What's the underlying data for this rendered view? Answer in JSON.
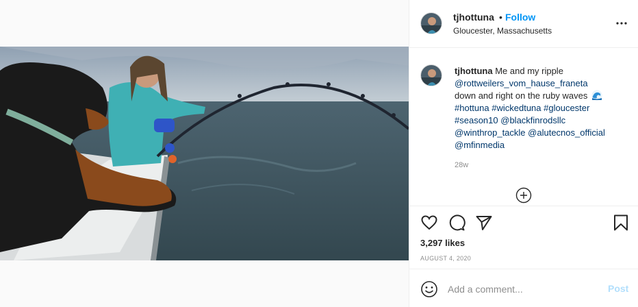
{
  "post": {
    "username": "tjhottuna",
    "dot": "•",
    "follow_label": "Follow",
    "location": "Gloucester, Massachusetts"
  },
  "caption": {
    "username": "tjhottuna",
    "lines": [
      "Me and my ripple",
      "@rottweilers_vom_hause_franeta",
      "down and right on the ruby waves",
      "#hottuna",
      "#wickedtuna",
      "#gloucester",
      "#season10",
      "@blackfinrodsllc",
      "@winthrop_tackle",
      "@alutecnos_official",
      "@mfinmedia"
    ],
    "time_ago": "28w"
  },
  "stats": {
    "likes": "3,297 likes",
    "date": "AUGUST 4, 2020"
  },
  "comment": {
    "placeholder": "Add a comment...",
    "post_label": "Post"
  },
  "icons": {
    "more": "more-options-icon",
    "load_more": "load-more-comments-icon",
    "like": "heart-icon",
    "comment": "comment-icon",
    "share": "paper-plane-icon",
    "save": "bookmark-icon",
    "emoji": "emoji-icon"
  },
  "colors": {
    "accent": "#0095f6",
    "link": "#00376b",
    "muted": "#8e8e8e",
    "post_disabled": "#b2dffc"
  }
}
